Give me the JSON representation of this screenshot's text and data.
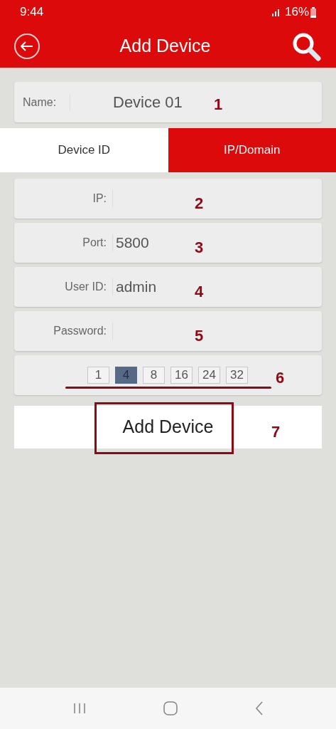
{
  "status_bar": {
    "time": "9:44",
    "battery": "16%"
  },
  "header": {
    "title": "Add Device"
  },
  "name_field": {
    "label": "Name:",
    "value": "Device 01",
    "annotation": "1"
  },
  "tabs": [
    {
      "label": "Device ID",
      "selected": false
    },
    {
      "label": "IP/Domain",
      "selected": true
    }
  ],
  "fields": [
    {
      "label": "IP:",
      "annotation": "2"
    },
    {
      "label": "Port:",
      "value": "5800",
      "annotation": "3"
    },
    {
      "label": "User ID:",
      "value": "admin",
      "annotation": "4"
    },
    {
      "label": "Password:",
      "annotation": "5"
    }
  ],
  "channels": {
    "annotation": "6",
    "options": [
      {
        "label": "1",
        "selected": false
      },
      {
        "label": "4",
        "selected": true
      },
      {
        "label": "8",
        "selected": false
      },
      {
        "label": "16",
        "selected": false
      },
      {
        "label": "24",
        "selected": false
      },
      {
        "label": "32",
        "selected": false
      }
    ]
  },
  "add_button": {
    "label": "Add Device",
    "annotation": "7"
  }
}
